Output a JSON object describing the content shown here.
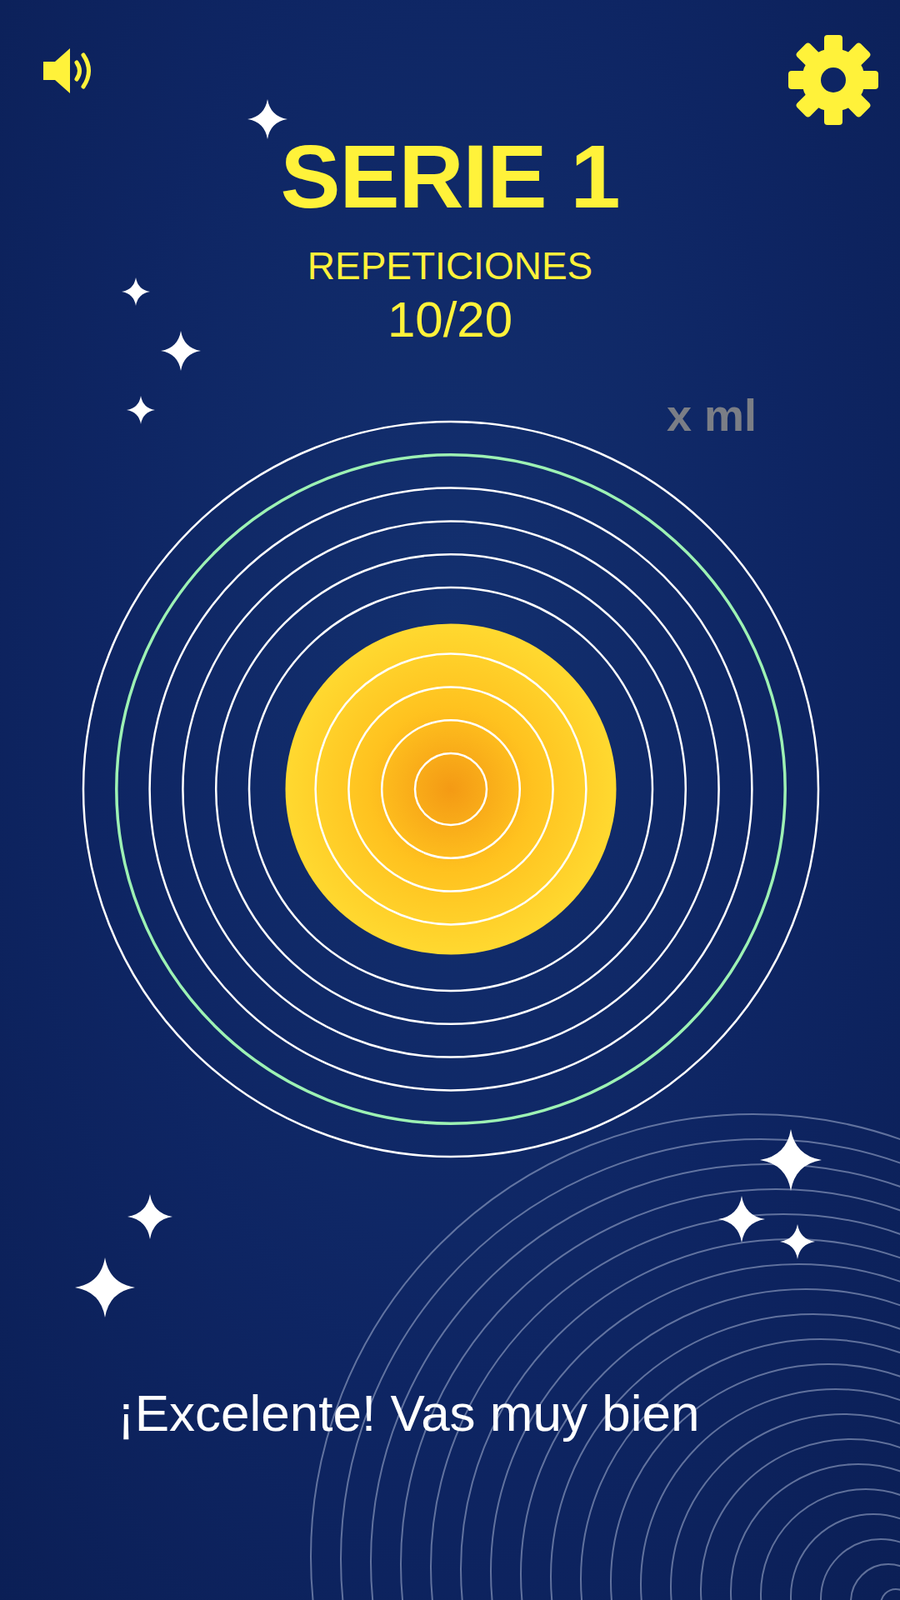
{
  "sound": {
    "on": true
  },
  "header": {
    "title": "SERIE 1",
    "subtitle": "REPETICIONES",
    "count": "10/20"
  },
  "volume": "x ml",
  "disc": {
    "level": 0.45
  },
  "rings": [
    {
      "selected": false
    },
    {
      "selected": true
    },
    {
      "selected": false
    },
    {
      "selected": false
    },
    {
      "selected": false
    },
    {
      "selected": false
    },
    {
      "selected": false
    },
    {
      "selected": false
    },
    {
      "selected": false
    },
    {
      "selected": false
    }
  ],
  "message": "¡Excelente! Vas muy bien"
}
